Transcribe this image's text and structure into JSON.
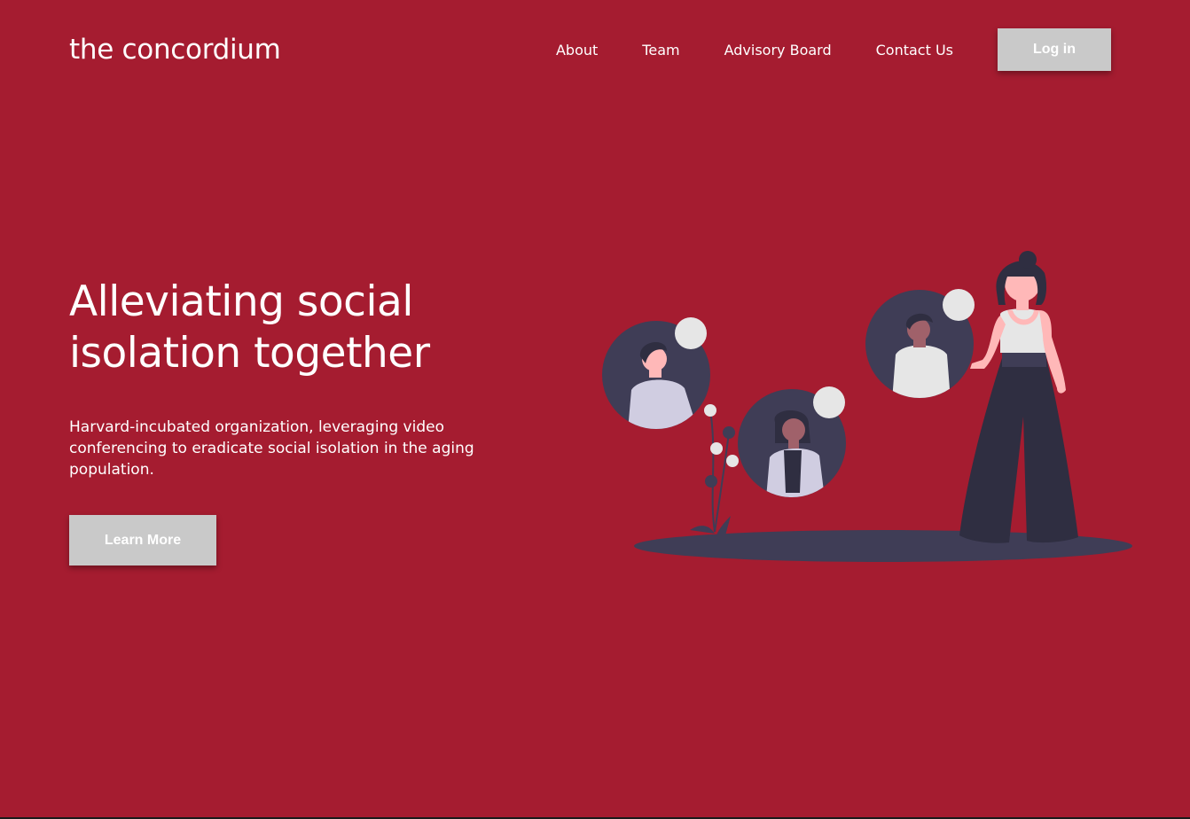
{
  "header": {
    "brand": "the concordium",
    "nav": [
      {
        "label": "About"
      },
      {
        "label": "Team"
      },
      {
        "label": "Advisory Board"
      },
      {
        "label": "Contact Us"
      }
    ],
    "login_label": "Log in"
  },
  "hero": {
    "title_line1": "Alleviating social",
    "title_line2": "isolation together",
    "subtitle": "Harvard-incubated organization, leveraging video conferencing to eradicate social isolation in the aging population.",
    "cta_label": "Learn More"
  },
  "illustration": {
    "icons": [
      "video-call-people-illustration",
      "woman-figure",
      "plant-icon"
    ],
    "colors": {
      "background": "#a51c30",
      "dark": "#3f3d56",
      "darker": "#2f2e41",
      "light": "#e6e6e6",
      "shirt": "#d0cde1",
      "skin_light": "#ffb8b8",
      "skin_dark": "#a0616a",
      "button": "#c9c9c9"
    }
  }
}
